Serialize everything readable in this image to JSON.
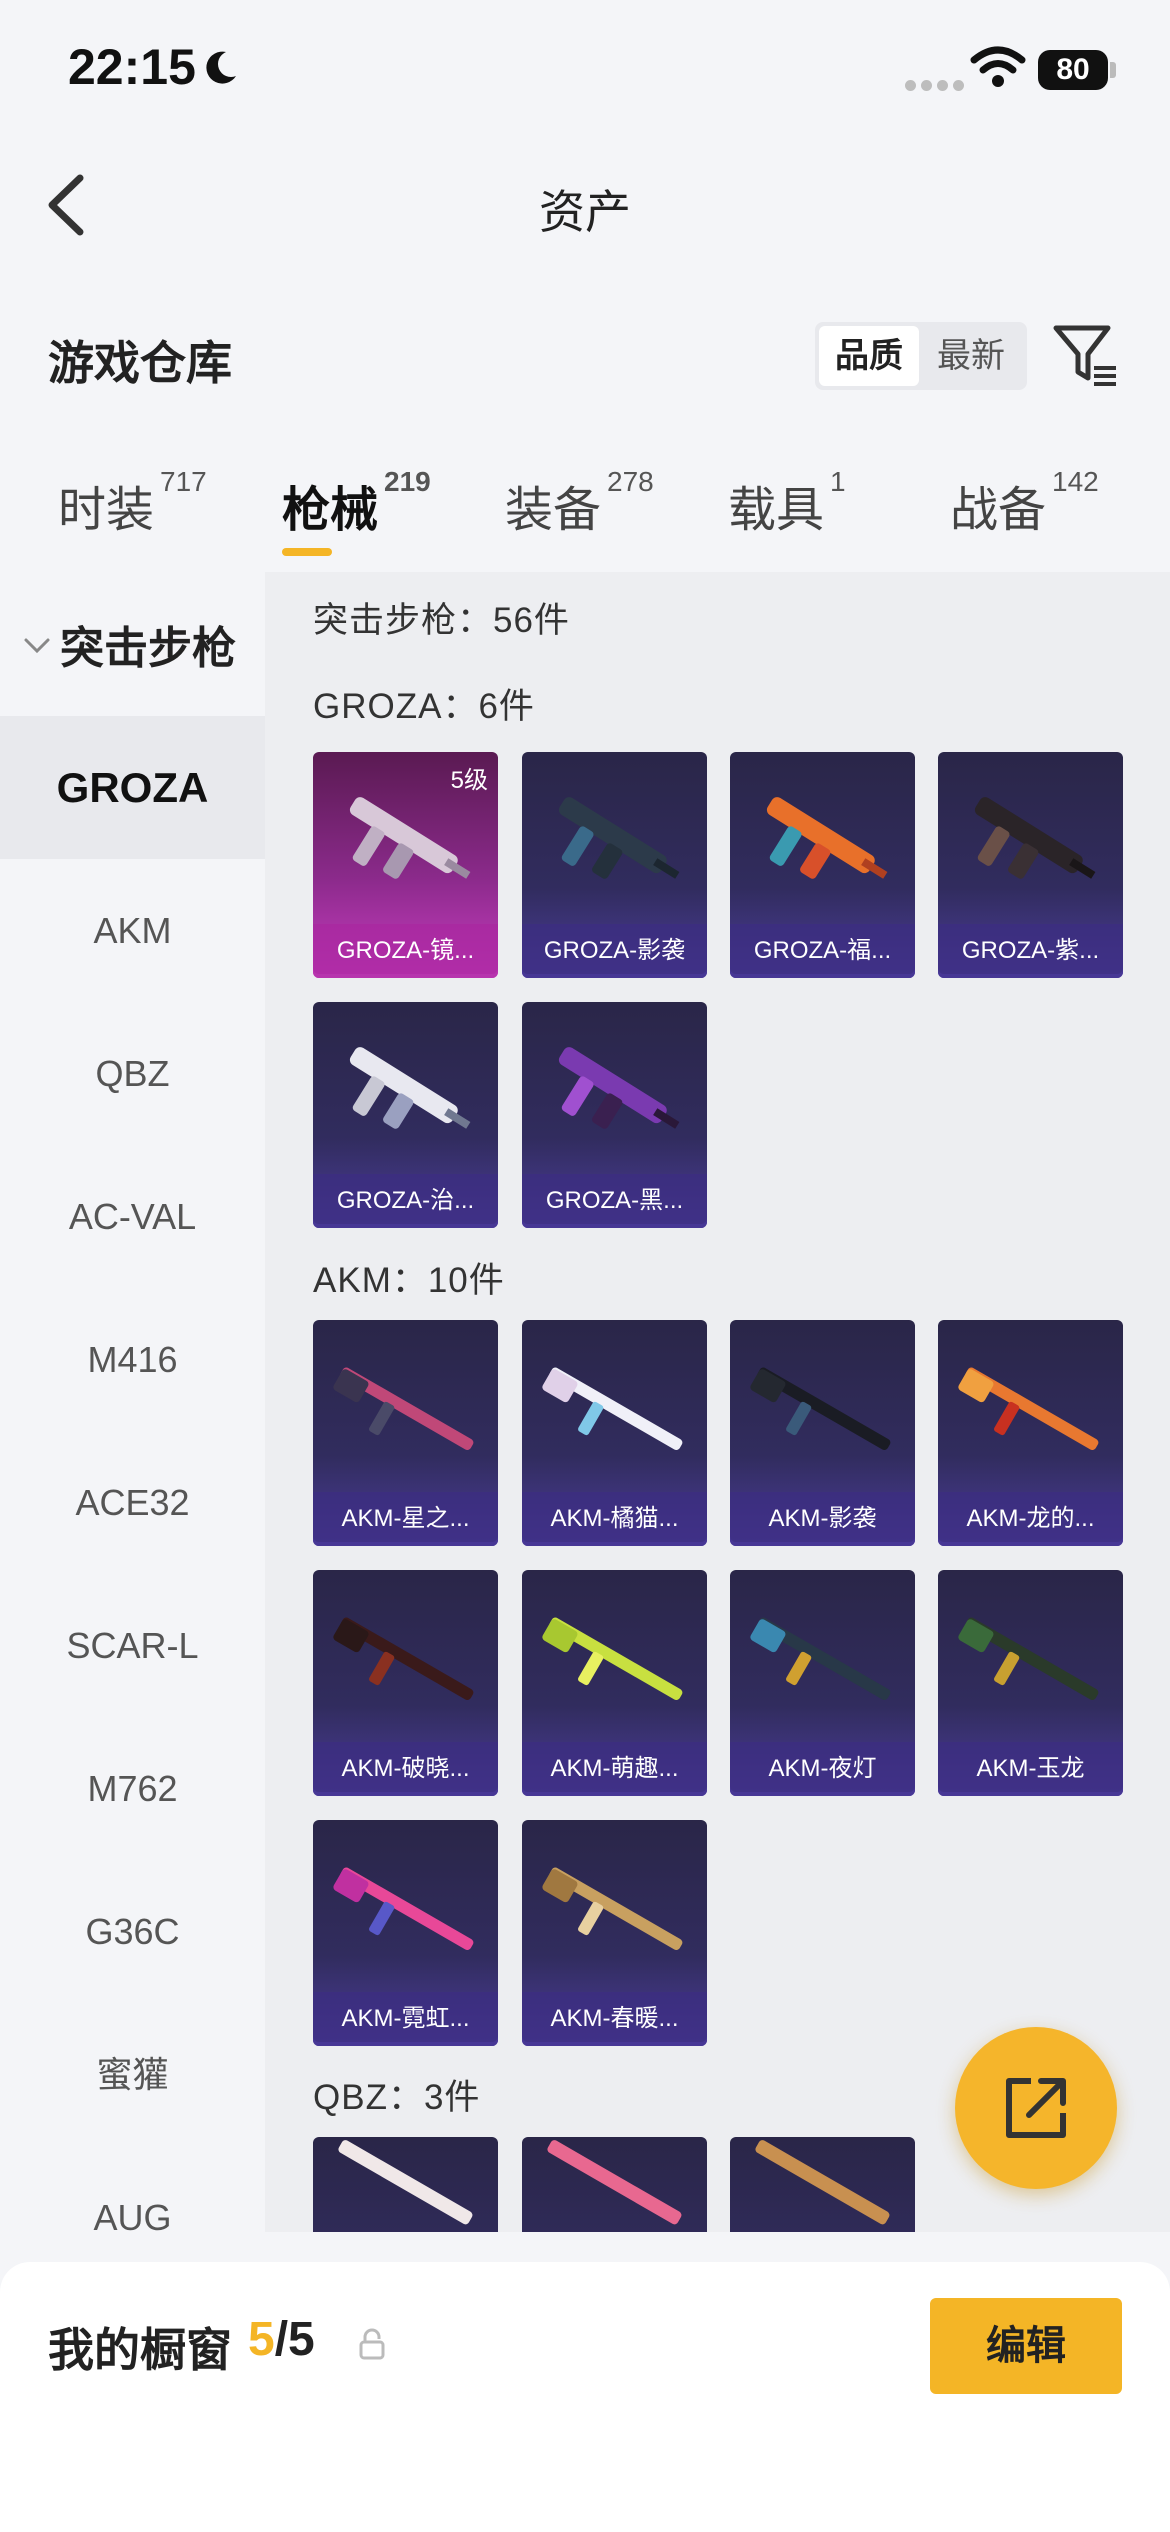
{
  "status_bar": {
    "time": "22:15",
    "battery": "80"
  },
  "nav": {
    "title": "资产"
  },
  "warehouse": {
    "title": "游戏仓库",
    "sort_quality": "品质",
    "sort_latest": "最新"
  },
  "tabs": [
    {
      "label": "时装",
      "count": "717"
    },
    {
      "label": "枪械",
      "count": "219"
    },
    {
      "label": "装备",
      "count": "278"
    },
    {
      "label": "载具",
      "count": "1"
    },
    {
      "label": "战备",
      "count": "142"
    }
  ],
  "sidebar": {
    "category": "突击步枪",
    "items": [
      "GROZA",
      "AKM",
      "QBZ",
      "AC-VAL",
      "M416",
      "ACE32",
      "SCAR-L",
      "M762",
      "G36C",
      "蜜獾",
      "AUG"
    ]
  },
  "content": {
    "summary": "突击步枪：56件",
    "sections": [
      {
        "header": "GROZA：6件",
        "items": [
          {
            "name": "GROZA-镜...",
            "level": "5级"
          },
          {
            "name": "GROZA-影袭"
          },
          {
            "name": "GROZA-福..."
          },
          {
            "name": "GROZA-紫..."
          },
          {
            "name": "GROZA-治..."
          },
          {
            "name": "GROZA-黑..."
          }
        ]
      },
      {
        "header": "AKM：10件",
        "items": [
          {
            "name": "AKM-星之..."
          },
          {
            "name": "AKM-橘猫..."
          },
          {
            "name": "AKM-影袭"
          },
          {
            "name": "AKM-龙的..."
          },
          {
            "name": "AKM-破晓..."
          },
          {
            "name": "AKM-萌趣..."
          },
          {
            "name": "AKM-夜灯"
          },
          {
            "name": "AKM-玉龙"
          },
          {
            "name": "AKM-霓虹..."
          },
          {
            "name": "AKM-春暖..."
          }
        ]
      },
      {
        "header": "QBZ：3件",
        "items": []
      }
    ]
  },
  "bottom": {
    "label": "我的橱窗",
    "current": "5",
    "total": "/5",
    "edit": "编辑"
  },
  "colors": {
    "accent": "#f4b526",
    "card": "#312c5e",
    "card_rare": "#c83cc0"
  }
}
